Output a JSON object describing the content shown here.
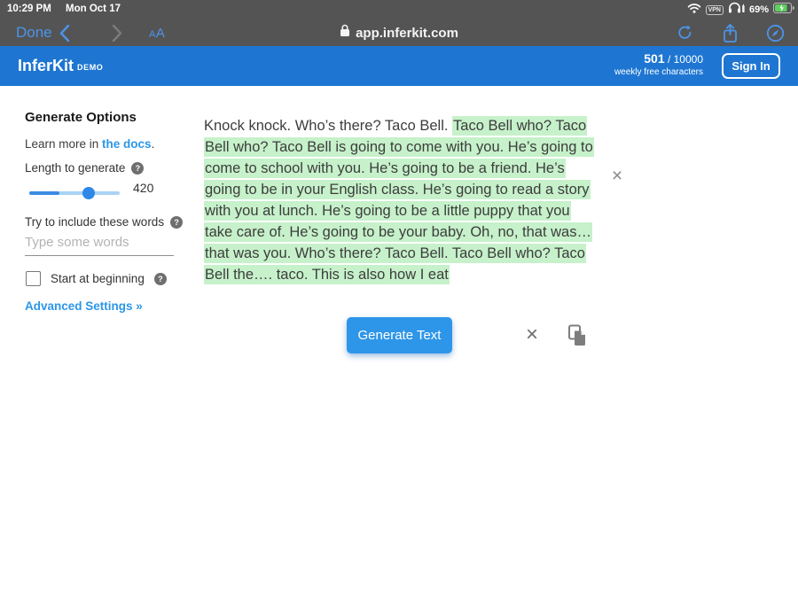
{
  "status_bar": {
    "time": "10:29 PM",
    "date": "Mon Oct 17",
    "vpn_label": "VPN",
    "battery_percent": "69%"
  },
  "browser": {
    "done_label": "Done",
    "reader_label_small": "A",
    "reader_label_large": "A",
    "url": "app.inferkit.com"
  },
  "header": {
    "brand": "InferKit",
    "brand_suffix": "DEMO",
    "quota_used": "501",
    "quota_rest": " / 10000",
    "quota_caption": "weekly free characters",
    "sign_in_label": "Sign In"
  },
  "sidebar": {
    "title": "Generate Options",
    "learn_more_prefix": "Learn more in ",
    "learn_more_link": "the docs",
    "learn_more_suffix": ".",
    "help_glyph": "?",
    "length_label": "Length to generate",
    "length_value": "420",
    "include_label": "Try to include these words",
    "include_placeholder": "Type some words",
    "checkbox_label": "Start at beginning",
    "advanced_link": "Advanced Settings »"
  },
  "main": {
    "prompt_text": "Knock knock. Who’s there? Taco Bell. ",
    "generated_text": "Taco Bell who? Taco Bell who? Taco Bell is going to come with you. He’s going to come to school with you. He’s going to be a friend. He’s going to be in your English class. He’s going to read a story with you at lunch. He’s going to be a little puppy that you take care of. He’s going to be your baby. Oh, no, that was… that was you. Who’s there? Taco Bell. Taco Bell who? Taco Bell the…. taco. This is also how I eat",
    "close_glyph": "×",
    "generate_button_label": "Generate Text",
    "clear_glyph": "×"
  },
  "colors": {
    "header_blue": "#1e76d2",
    "accent_blue": "#2e96e8",
    "link_blue": "#2b96e8",
    "highlight_green": "#c6f1ca",
    "chrome_gray": "#545454",
    "battery_green": "#5bd15e"
  }
}
